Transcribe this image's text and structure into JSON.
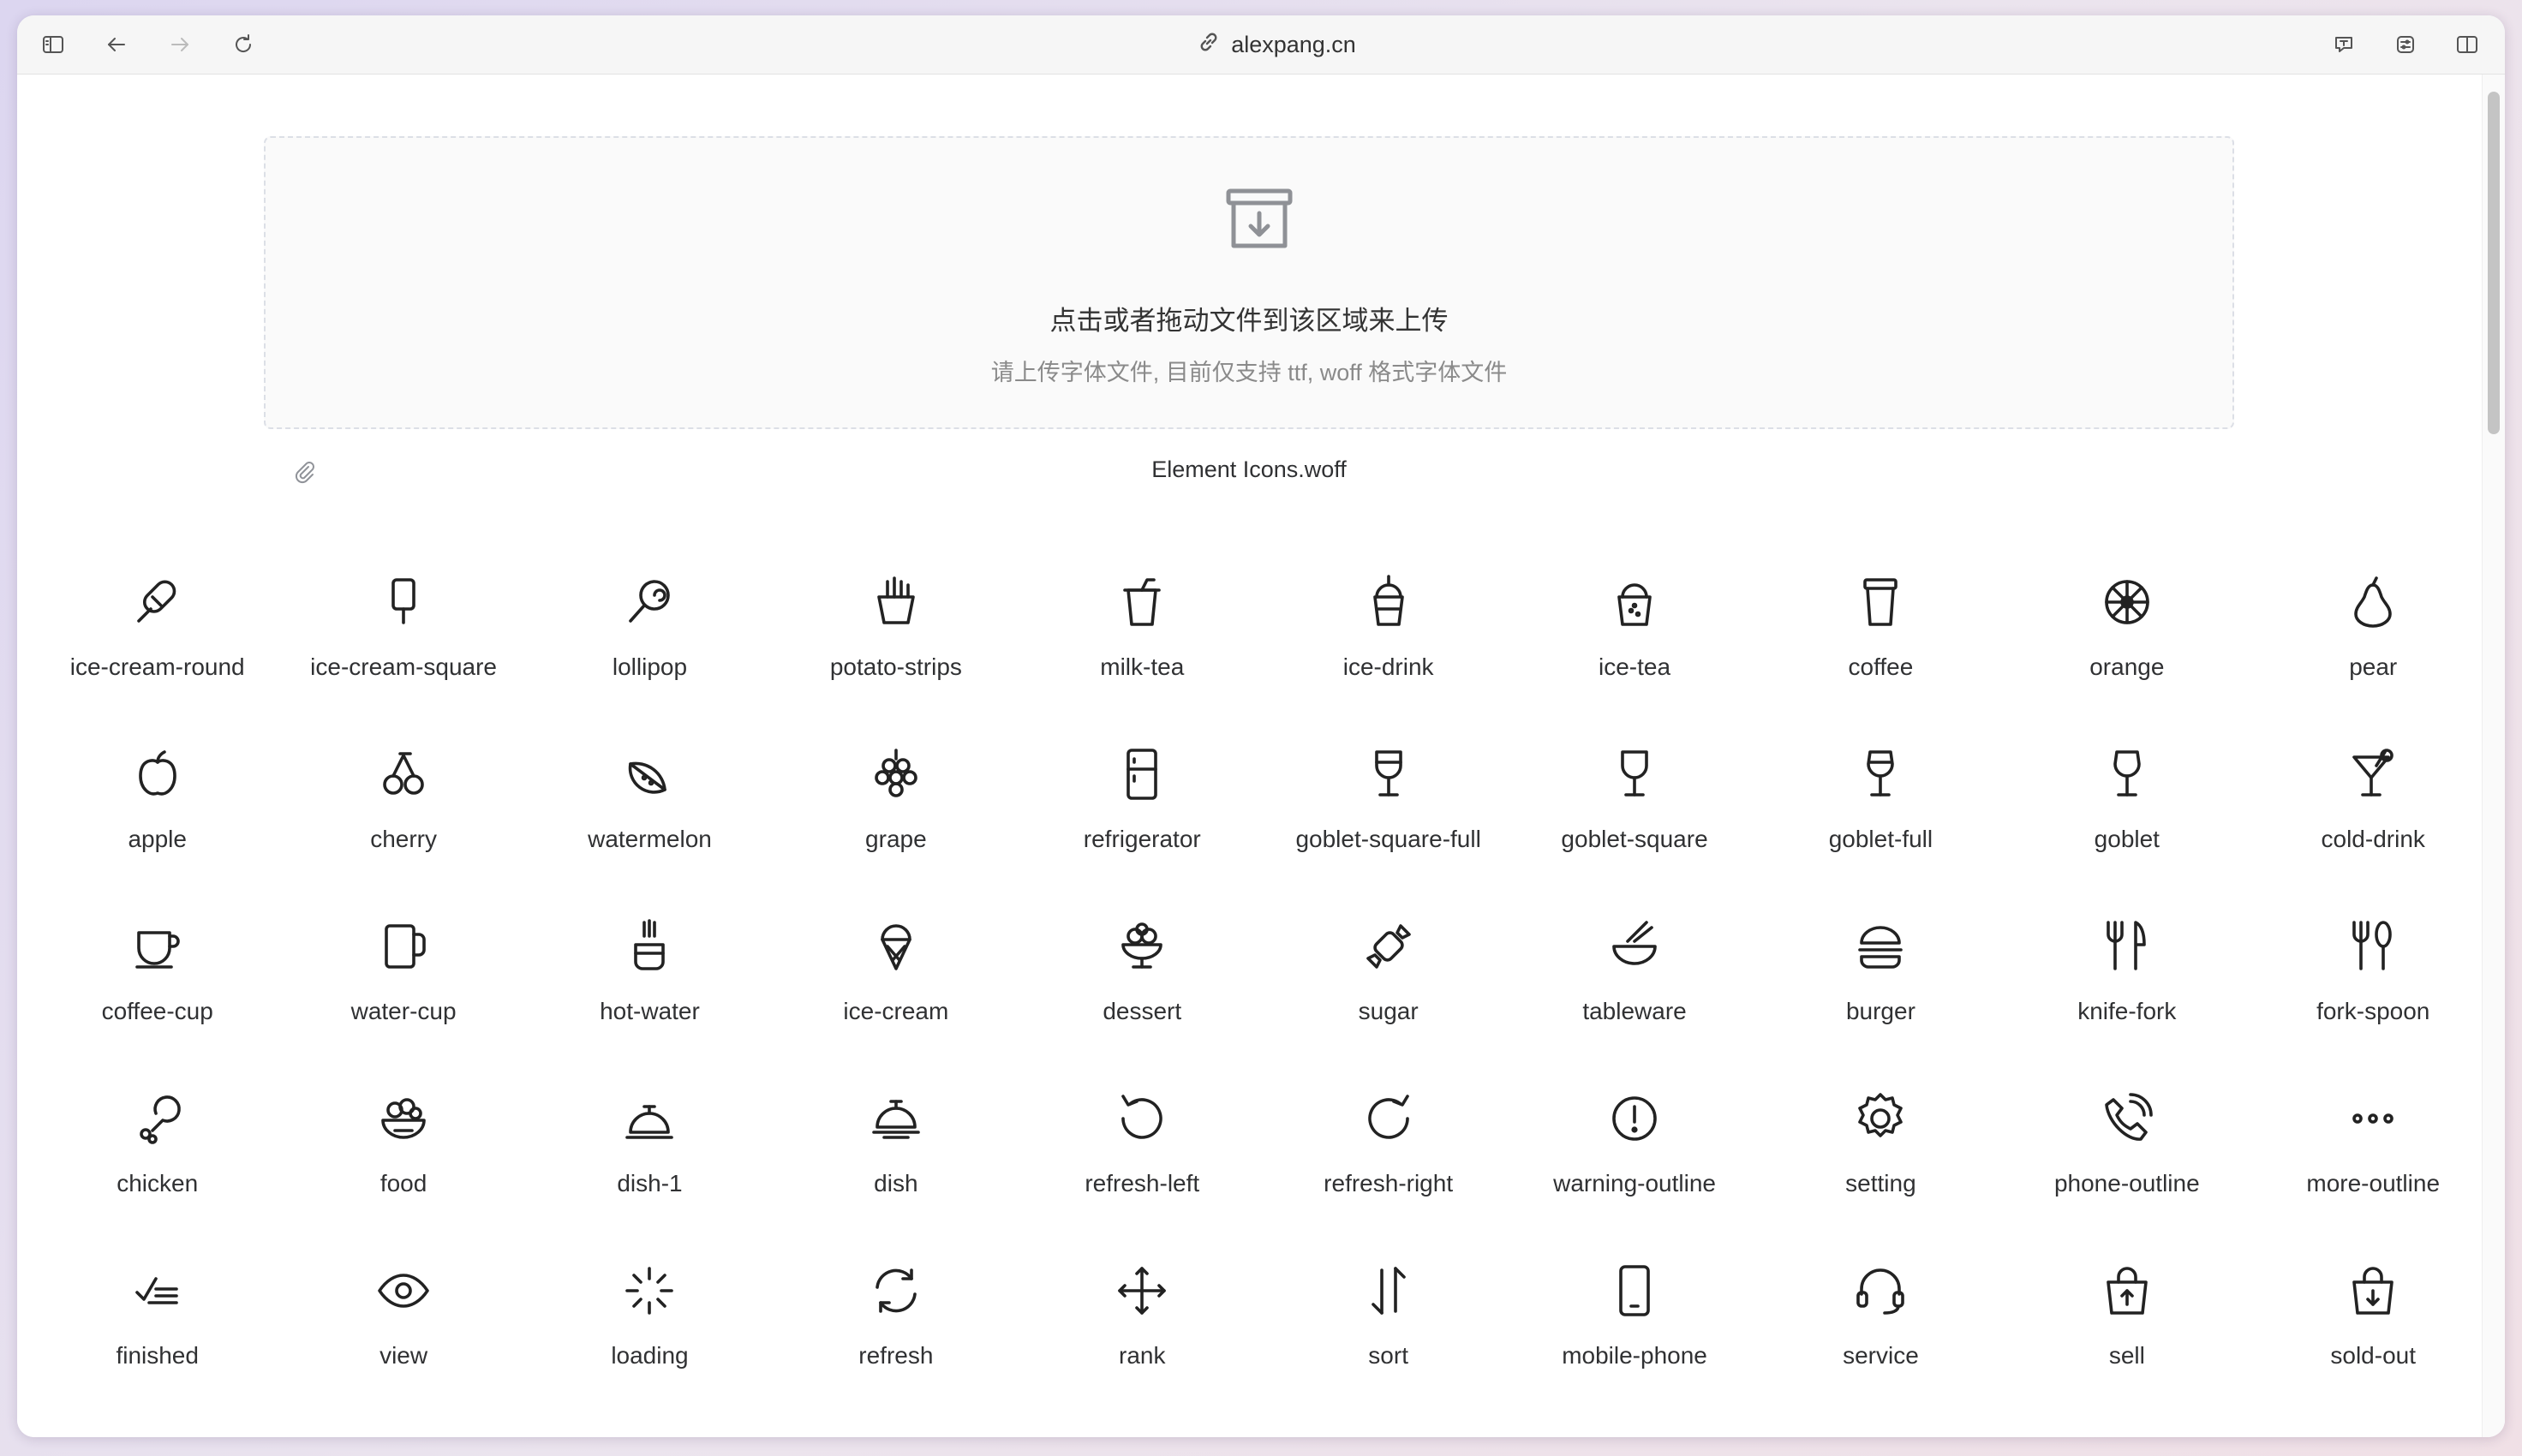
{
  "browser": {
    "address": "alexpang.cn",
    "buttons": {
      "sidebar": "sidebar-toggle-icon",
      "back": "back-arrow-icon",
      "forward": "forward-arrow-icon",
      "reload": "reload-icon",
      "translate": "translate-icon",
      "extensions": "extension-icon",
      "split": "split-view-icon"
    }
  },
  "upload": {
    "title": "点击或者拖动文件到该区域来上传",
    "tip": "请上传字体文件, 目前仅支持 ttf, woff 格式字体文件"
  },
  "file": {
    "name": "Element Icons.woff"
  },
  "icons": [
    "ice-cream-round",
    "ice-cream-square",
    "lollipop",
    "potato-strips",
    "milk-tea",
    "ice-drink",
    "ice-tea",
    "coffee",
    "orange",
    "pear",
    "apple",
    "cherry",
    "watermelon",
    "grape",
    "refrigerator",
    "goblet-square-full",
    "goblet-square",
    "goblet-full",
    "goblet",
    "cold-drink",
    "coffee-cup",
    "water-cup",
    "hot-water",
    "ice-cream",
    "dessert",
    "sugar",
    "tableware",
    "burger",
    "knife-fork",
    "fork-spoon",
    "chicken",
    "food",
    "dish-1",
    "dish",
    "refresh-left",
    "refresh-right",
    "warning-outline",
    "setting",
    "phone-outline",
    "more-outline",
    "finished",
    "view",
    "loading",
    "refresh",
    "rank",
    "sort",
    "mobile-phone",
    "service",
    "sell",
    "sold-out"
  ]
}
